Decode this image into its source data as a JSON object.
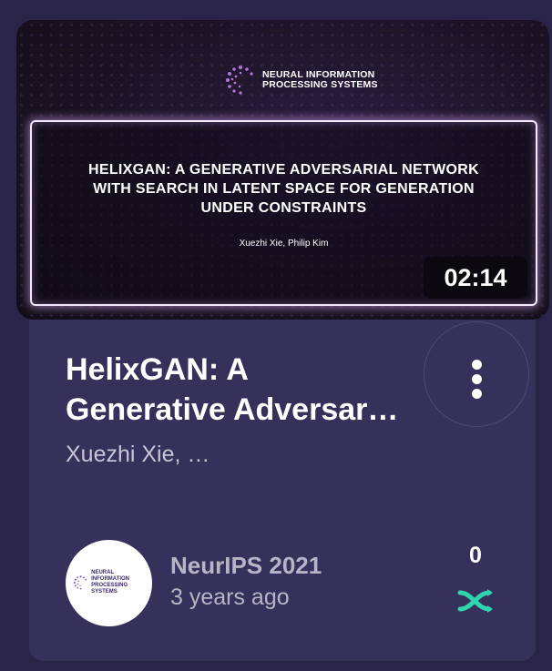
{
  "video": {
    "thumbnail": {
      "logo_line1": "NEURAL INFORMATION",
      "logo_line2": "PROCESSING SYSTEMS",
      "slide_title": "HELIXGAN: A GENERATIVE ADVERSARIAL NETWORK\nWITH SEARCH IN LATENT SPACE FOR GENERATION\nUNDER CONSTRAINTS",
      "slide_authors": "Xuezhi Xie, Philip Kim",
      "duration": "02:14"
    },
    "title": "HelixGAN: A\nGenerative Adversar…",
    "authors": "Xuezhi Xie, …",
    "channel": {
      "name": "NeurIPS 2021",
      "age": "3 years ago",
      "avatar_line1": "NEURAL INFORMATION",
      "avatar_line2": "PROCESSING SYSTEMS"
    },
    "count": "0",
    "icons": {
      "more": "more-vertical-icon",
      "reaction": "shuffle-icon"
    },
    "colors": {
      "background": "#2a2548",
      "card": "#36315a",
      "accent": "#2ed6b0"
    }
  }
}
